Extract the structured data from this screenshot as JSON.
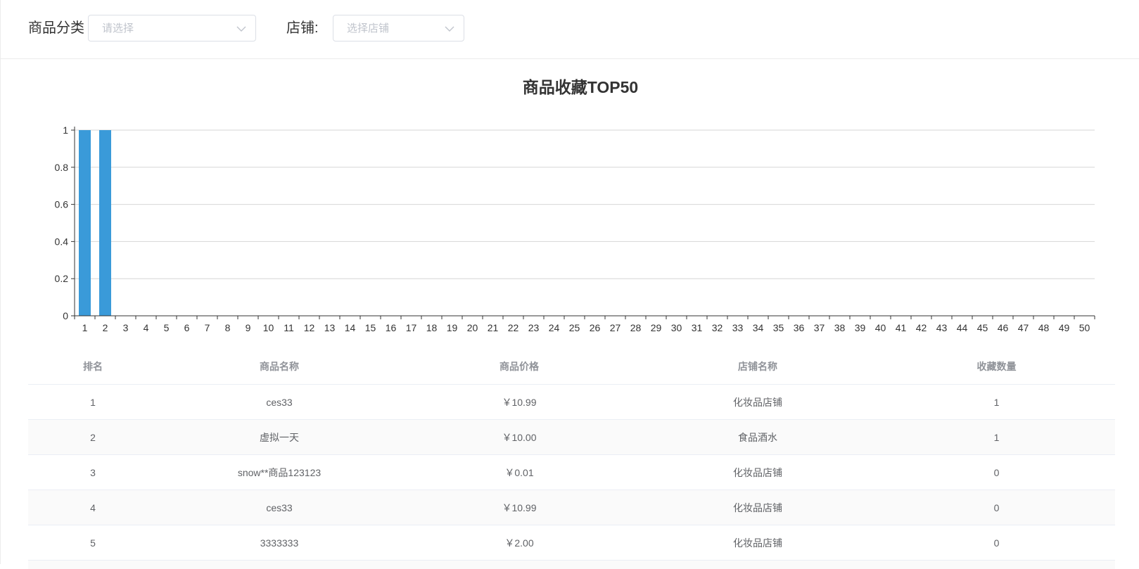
{
  "filters": {
    "category_label": "商品分类",
    "category_placeholder": "请选择",
    "shop_label": "店铺:",
    "shop_placeholder": "选择店铺"
  },
  "chart_data": {
    "type": "bar",
    "title": "商品收藏TOP50",
    "xlabel": "",
    "ylabel": "",
    "categories": [
      "1",
      "2",
      "3",
      "4",
      "5",
      "6",
      "7",
      "8",
      "9",
      "10",
      "11",
      "12",
      "13",
      "14",
      "15",
      "16",
      "17",
      "18",
      "19",
      "20",
      "21",
      "22",
      "23",
      "24",
      "25",
      "26",
      "27",
      "28",
      "29",
      "30",
      "31",
      "32",
      "33",
      "34",
      "35",
      "36",
      "37",
      "38",
      "39",
      "40",
      "41",
      "42",
      "43",
      "44",
      "45",
      "46",
      "47",
      "48",
      "49",
      "50"
    ],
    "values": [
      1,
      1,
      0,
      0,
      0,
      0,
      0,
      0,
      0,
      0,
      0,
      0,
      0,
      0,
      0,
      0,
      0,
      0,
      0,
      0,
      0,
      0,
      0,
      0,
      0,
      0,
      0,
      0,
      0,
      0,
      0,
      0,
      0,
      0,
      0,
      0,
      0,
      0,
      0,
      0,
      0,
      0,
      0,
      0,
      0,
      0,
      0,
      0,
      0,
      0
    ],
    "ylim": [
      0,
      1
    ],
    "yticks": [
      "0",
      "0.2",
      "0.4",
      "0.6",
      "0.8",
      "1"
    ],
    "grid": true,
    "bar_color": "#3a9ad9"
  },
  "table": {
    "headers": [
      "排名",
      "商品名称",
      "商品价格",
      "店铺名称",
      "收藏数量"
    ],
    "rows": [
      [
        "1",
        "ces33",
        "￥10.99",
        "化妆品店铺",
        "1"
      ],
      [
        "2",
        "虚拟一天",
        "￥10.00",
        "食品酒水",
        "1"
      ],
      [
        "3",
        "snow**商品123123",
        "￥0.01",
        "化妆品店铺",
        "0"
      ],
      [
        "4",
        "ces33",
        "￥10.99",
        "化妆品店铺",
        "0"
      ],
      [
        "5",
        "3333333",
        "￥2.00",
        "化妆品店铺",
        "0"
      ]
    ]
  }
}
